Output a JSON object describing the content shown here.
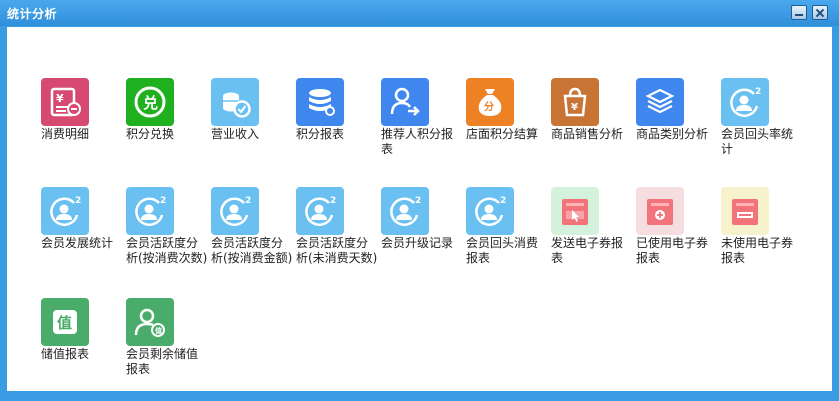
{
  "window": {
    "title": "统计分析"
  },
  "colors": {
    "frame": "#3a9be2",
    "crimson": "#d64a71",
    "green": "#1fb01f",
    "sky": "#6ac0f0",
    "blue": "#3f86ee",
    "orange": "#ee8124",
    "brown": "#c87434",
    "mint": "#4aac6a",
    "pink": "#f2737a",
    "pinkBg": "#f6dde0",
    "mintBg": "#d4f1dc",
    "cream": "#f6f3cc"
  },
  "items": [
    {
      "label": "消费明细",
      "icon": "receipt-icon"
    },
    {
      "label": "积分兑换",
      "icon": "points-exchange-icon"
    },
    {
      "label": "营业收入",
      "icon": "coins-icon"
    },
    {
      "label": "积分报表",
      "icon": "database-icon"
    },
    {
      "label": "推荐人积分报表",
      "icon": "referrer-icon"
    },
    {
      "label": "店面积分结算",
      "icon": "money-bag-icon"
    },
    {
      "label": "商品销售分析",
      "icon": "shopping-bag-icon"
    },
    {
      "label": "商品类别分析",
      "icon": "layers-icon"
    },
    {
      "label": "会员回头率统计",
      "icon": "member-return-icon"
    },
    {
      "label": "会员发展统计",
      "icon": "member-growth-icon"
    },
    {
      "label": "会员活跃度分析(按消费次数)",
      "icon": "member-activity-icon"
    },
    {
      "label": "会员活跃度分析(按消费金额)",
      "icon": "member-activity-icon"
    },
    {
      "label": "会员活跃度分析(未消费天数)",
      "icon": "member-activity-icon"
    },
    {
      "label": "会员升级记录",
      "icon": "member-upgrade-icon"
    },
    {
      "label": "会员回头消费报表",
      "icon": "member-return-report-icon"
    },
    {
      "label": "发送电子券报表",
      "icon": "send-coupon-icon"
    },
    {
      "label": "已使用电子券报表",
      "icon": "used-coupon-icon"
    },
    {
      "label": "未使用电子券报表",
      "icon": "unused-coupon-icon"
    },
    {
      "label": "储值报表",
      "icon": "stored-value-icon"
    },
    {
      "label": "会员剩余储值报表",
      "icon": "member-balance-icon"
    }
  ]
}
